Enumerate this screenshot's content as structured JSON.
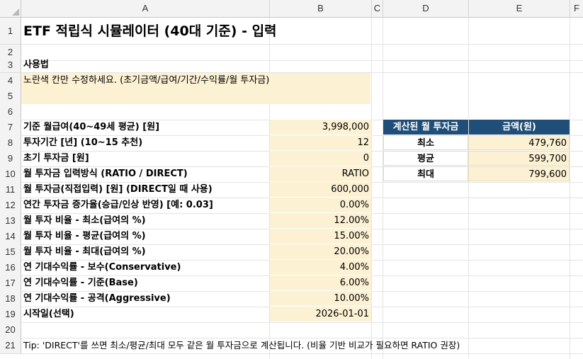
{
  "columns": [
    "A",
    "B",
    "C",
    "D",
    "E",
    "F"
  ],
  "rows": [
    "1",
    "2",
    "3",
    "4",
    "5",
    "6",
    "7",
    "8",
    "9",
    "10",
    "11",
    "12",
    "13",
    "14",
    "15",
    "16",
    "17",
    "18",
    "19",
    "20",
    "21"
  ],
  "title": "ETF 적립식 시뮬레이터 (40대 기준) - 입력",
  "usage": {
    "heading": "사용법",
    "text": "노란색 칸만 수정하세요. (초기금액/급여/기간/수익률/월 투자금)"
  },
  "inputs": [
    {
      "label": "기준 월급여(40~49세 평균) [원]",
      "value": "3,998,000"
    },
    {
      "label": "투자기간 [년] (10~15 추천)",
      "value": "12"
    },
    {
      "label": "초기 투자금 [원]",
      "value": "0"
    },
    {
      "label": "월 투자금 입력방식 (RATIO / DIRECT)",
      "value": "RATIO"
    },
    {
      "label": "월 투자금(직접입력) [원]  (DIRECT일 때 사용)",
      "value": "600,000"
    },
    {
      "label": "연간 투자금 증가율(승급/인상 반영) [예: 0.03]",
      "value": "0.00%"
    },
    {
      "label": "월 투자 비율 - 최소(급여의 %)",
      "value": "12.00%"
    },
    {
      "label": "월 투자 비율 - 평균(급여의 %)",
      "value": "15.00%"
    },
    {
      "label": "월 투자 비율 - 최대(급여의 %)",
      "value": "20.00%"
    },
    {
      "label": "연 기대수익률 - 보수(Conservative)",
      "value": "4.00%"
    },
    {
      "label": "연 기대수익률 - 기준(Base)",
      "value": "6.00%"
    },
    {
      "label": "연 기대수익률 - 공격(Aggressive)",
      "value": "10.00%"
    },
    {
      "label": "시작일(선택)",
      "value": "2026-01-01"
    }
  ],
  "calc_table": {
    "header_label": "계산된 월 투자금",
    "header_value": "금액(원)",
    "rows": [
      {
        "label": "최소",
        "value": "479,760"
      },
      {
        "label": "평균",
        "value": "599,700"
      },
      {
        "label": "최대",
        "value": "799,600"
      }
    ]
  },
  "tip": "Tip: 'DIRECT'를 쓰면 최소/평균/최대 모두 같은 월 투자금으로 계산됩니다. (비율 기반 비교가 필요하면 RATIO 권장)",
  "colors": {
    "input_fill": "#fdf1d3",
    "table_header": "#1f4e78",
    "header_bg": "#f3f3f3"
  }
}
